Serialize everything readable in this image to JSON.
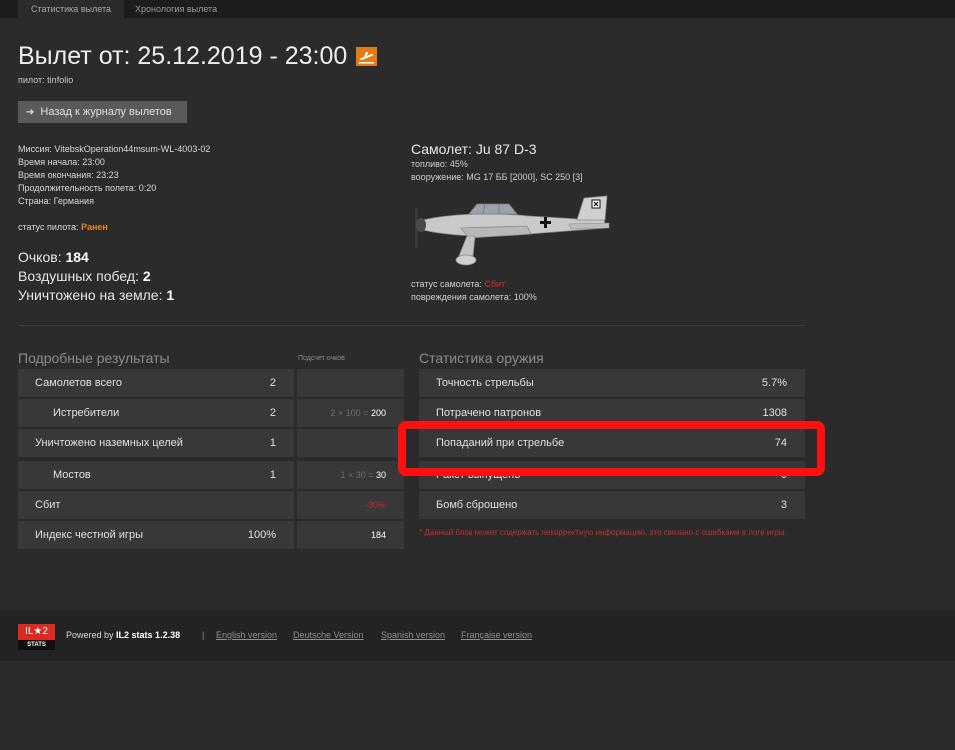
{
  "tabs": [
    "Статистика вылета",
    "Хронология вылета"
  ],
  "header": {
    "title": "Вылет от: 25.12.2019 - 23:00",
    "pilot": "пилот: tinfolio",
    "back_label": "Назад к журналу вылетов"
  },
  "mission": {
    "mission": "Миссия: VitebskOperation44msum-WL-4003-02",
    "start": "Время начала: 23:00",
    "end": "Время окончания: 23:23",
    "duration": "Продолжительность полета: 0:20",
    "country": "Страна: Германия",
    "status_label": "статус пилота:",
    "status_value": "Ранен"
  },
  "summary": {
    "score_label": "Очков:",
    "score_value": "184",
    "air_label": "Воздушных побед:",
    "air_value": "2",
    "ground_label": "Уничтожено на земле:",
    "ground_value": "1"
  },
  "plane": {
    "title": "Самолет: Ju 87 D-3",
    "fuel": "топливо: 45%",
    "armament": "вооружение: MG 17 ББ [2000], SC 250 [3]",
    "status_label": "статус самолета:",
    "status_value": "Сбит",
    "damage": "повреждения самолета: 100%",
    "cross_icon": "balkenkreuz-icon"
  },
  "results": {
    "title": "Подробные результаты",
    "points_header": "Подсчет очков",
    "rows": [
      {
        "label": "Самолетов всего",
        "value": "2",
        "calc": "",
        "points": ""
      },
      {
        "label": "Истребители",
        "value": "2",
        "calc": "2 × 100 =",
        "points": "200"
      },
      {
        "label": "Уничтожено наземных целей",
        "value": "1",
        "calc": "",
        "points": ""
      },
      {
        "label": "Мостов",
        "value": "1",
        "calc": "1 × 30 =",
        "points": "30"
      },
      {
        "label": "Сбит",
        "value": "",
        "calc": "",
        "points": "-30%"
      },
      {
        "label": "Индекс честной игры",
        "value": "100%",
        "calc": "",
        "points": "184"
      }
    ]
  },
  "weapons": {
    "title": "Статистика оружия",
    "rows": [
      {
        "label": "Точность стрельбы",
        "value": "5.7%"
      },
      {
        "label": "Потрачено патронов",
        "value": "1308"
      },
      {
        "label": "Попаданий при стрельбе",
        "value": "74"
      },
      {
        "label": "Ракет выпущено",
        "value": "0"
      },
      {
        "label": "Бомб сброшено",
        "value": "3"
      }
    ],
    "note": "* Данный блок может содержать некорректную информацию, это связано с ошибками в логе игры."
  },
  "footer": {
    "logo_top": "IL★2",
    "logo_bottom": "STATS",
    "powered_prefix": "Powered by",
    "powered_brand": "IL2 stats 1.2.38",
    "separator": "|",
    "languages": [
      "English version",
      "Deutsche Version",
      "Spanish version",
      "Française version"
    ]
  },
  "colors": {
    "accent": "#e07b18",
    "danger": "#d42a2a",
    "highlight": "#ff1010"
  }
}
